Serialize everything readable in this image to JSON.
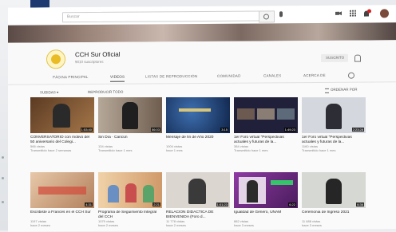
{
  "header": {
    "search_placeholder": "Buscar"
  },
  "channel": {
    "name": "CCH Sur Oficial",
    "subscribers": "9010 suscriptores",
    "subscribe_label": "SUSCRITO"
  },
  "tabs": [
    "PÁGINA PRINCIPAL",
    "VIDEOS",
    "LISTAS DE REPRODUCCIÓN",
    "COMUNIDAD",
    "CANALES",
    "ACERCA DE"
  ],
  "filters": {
    "uploads": "SUBIDAS ▾",
    "play_all": "REPRODUCIR TODO",
    "sort": "ORDENAR POR"
  },
  "videos": [
    {
      "title": "CONVERSATORIO con motivo del 50 aniversario del Colegi...",
      "meta1": "566 vistas",
      "meta2": "Transmitido hace 2 semanas",
      "duration": "1:53:40",
      "color": "#6a4a2e"
    },
    {
      "title": "Sin Día · Cancún",
      "meta1": "134 vistas",
      "meta2": "Transmitido hace 1 mes",
      "duration": "56:03",
      "color": "#8c7a6a"
    },
    {
      "title": "Mensaje de fin de Año 2020",
      "meta1": "1004 vistas",
      "meta2": "hace 1 mes",
      "duration": "3:15",
      "color": "#1d3a6a"
    },
    {
      "title": "1er Foro virtual \"Perspectivas actuales y futuras de la...",
      "meta1": "384 vistas",
      "meta2": "Transmitido hace 1 mes",
      "duration": "1:49:23",
      "color": "#2a2a40"
    },
    {
      "title": "1er Foro virtual \"Perspectivas actuales y futuras de la...",
      "meta1": "1160 vistas",
      "meta2": "Transmitido hace 1 mes",
      "duration": "2:23:28",
      "color": "#cfd4dc"
    },
    {
      "title": "Escribiste a Francés en el CCH Sur",
      "meta1": "1197 vistas",
      "meta2": "hace 2 meses",
      "duration": "4:31",
      "color": "#c9a282"
    },
    {
      "title": "Programa de Seguimiento Integral del CCH",
      "meta1": "1079 vistas",
      "meta2": "hace 2 meses",
      "duration": "2:21",
      "color": "#e6b68a"
    },
    {
      "title": "RELACIÓN DIDÁCTICA DE BIENVENIDA (Foro d...",
      "meta1": "11 778 vistas",
      "meta2": "hace 2 meses",
      "duration": "1:01:23",
      "color": "#d8d2cc"
    },
    {
      "title": "Igualdad de Género, UNAM",
      "meta1": "882 vistas",
      "meta2": "hace 3 meses",
      "duration": "6:22",
      "color": "#7b2f8e"
    },
    {
      "title": "Ceremonia de Ingreso 2021",
      "meta1": "11 688 vistas",
      "meta2": "hace 3 meses",
      "duration": "6:36",
      "color": "#d6d8d3"
    }
  ]
}
